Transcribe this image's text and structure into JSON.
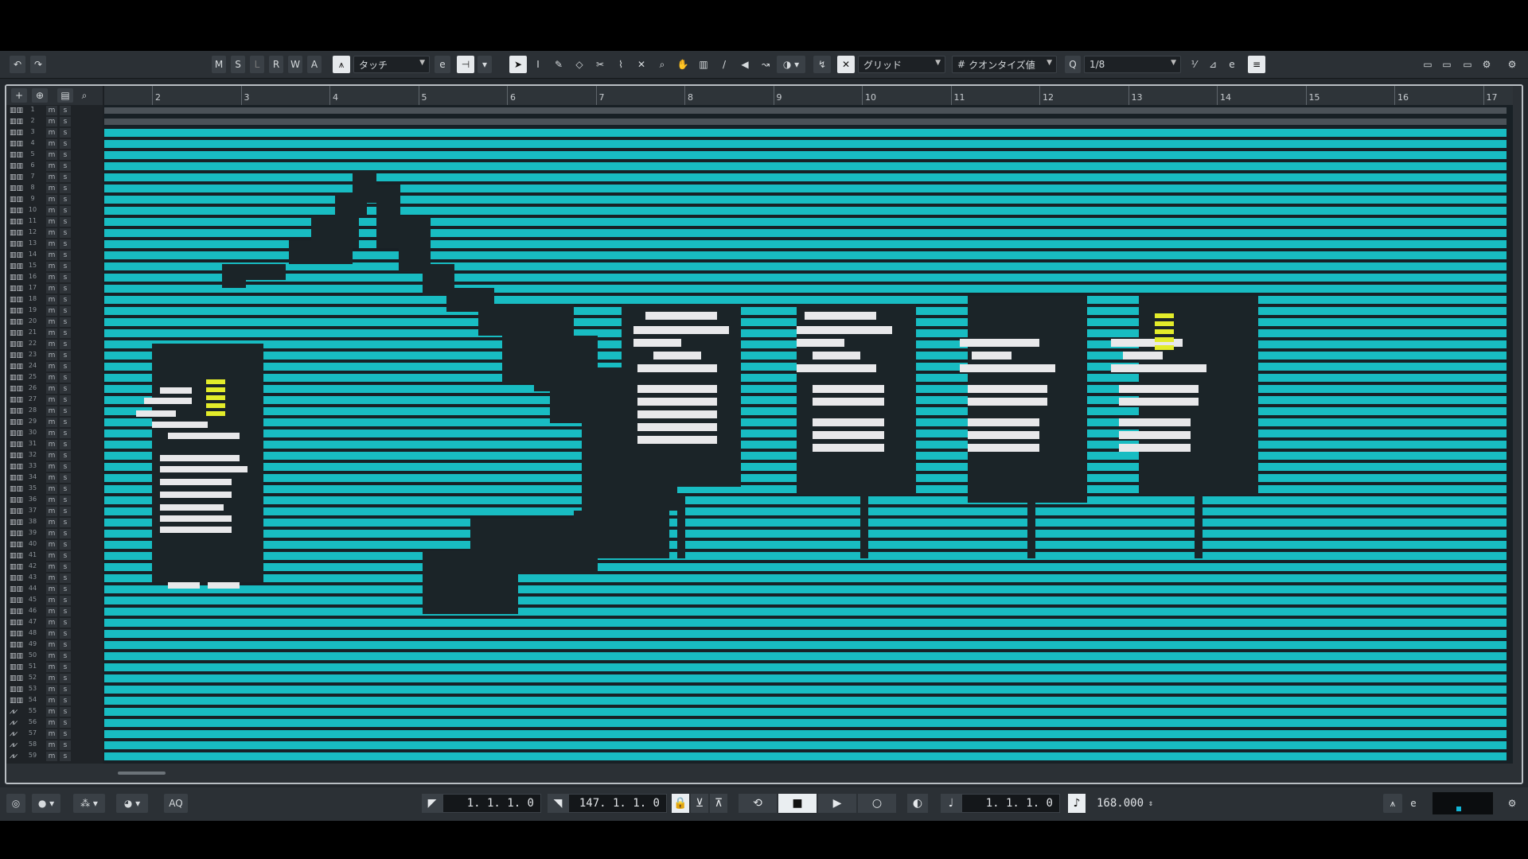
{
  "toolbar": {
    "undo": "↶",
    "redo": "↷",
    "modes": [
      "M",
      "S",
      "L",
      "R",
      "W",
      "A"
    ],
    "automation_mode": "タッチ",
    "snap_type": "グリッド",
    "quantize_type": "クオンタイズ値",
    "quantize_value": "1/8",
    "q_icon": "Q",
    "hash_icon": "#"
  },
  "ruler": {
    "bars": [
      "2",
      "3",
      "4",
      "5",
      "6",
      "7",
      "8",
      "9",
      "10",
      "11",
      "12",
      "13",
      "14",
      "15",
      "16",
      "17"
    ]
  },
  "tracks": {
    "numbers": [
      "1",
      "2",
      "3",
      "4",
      "5",
      "6",
      "7",
      "8",
      "9",
      "10",
      "11",
      "12",
      "13",
      "14",
      "15",
      "16",
      "17",
      "18",
      "19",
      "20",
      "21",
      "22",
      "23",
      "24",
      "25",
      "26",
      "27",
      "28",
      "29",
      "30",
      "31",
      "32",
      "33",
      "34",
      "35",
      "36",
      "37",
      "38",
      "39",
      "40",
      "41",
      "42",
      "43",
      "44",
      "45",
      "46",
      "47",
      "48",
      "49",
      "50",
      "51",
      "52",
      "53",
      "54",
      "55",
      "56",
      "57",
      "58",
      "59"
    ],
    "mute_label": "m",
    "solo_label": "s"
  },
  "transport": {
    "left_locator": "1.  1.  1.    0",
    "right_locator": "147.  1.  1.    0",
    "position": "1.  1.  1.    0",
    "tempo": "168.000",
    "aq": "AQ"
  },
  "colors": {
    "event": "#18bcc2",
    "event_dark": "#0e8f94",
    "gap": "#1b2428",
    "white": "#e8e8ea",
    "yellow": "#e3ec2a"
  }
}
